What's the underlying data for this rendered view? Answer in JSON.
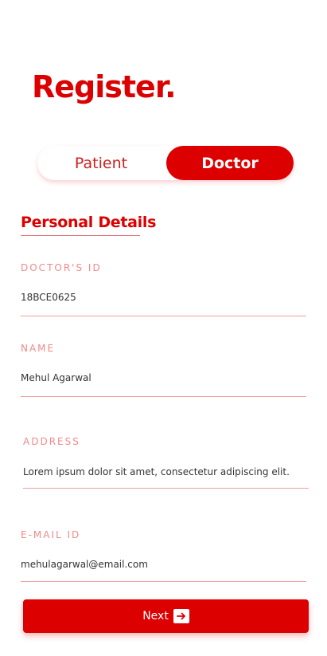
{
  "header": {
    "title": "Register."
  },
  "role_toggle": {
    "options": [
      "Patient",
      "Doctor"
    ],
    "selected": "Doctor"
  },
  "section": {
    "title": "Personal Details"
  },
  "fields": [
    {
      "label": "DOCTOR'S ID",
      "value": "18BCE0625"
    },
    {
      "label": "NAME",
      "value": "Mehul Agarwal"
    },
    {
      "label": "ADDRESS",
      "value": "Lorem ipsum dolor sit amet, consectetur adipiscing elit."
    },
    {
      "label": "E-MAIL ID",
      "value": "mehulagarwal@email.com"
    }
  ],
  "actions": {
    "next_label": "Next"
  },
  "icons": {
    "next": "arrow-right-icon"
  },
  "colors": {
    "accent": "#dc0000",
    "label": "#f08a8a",
    "underline": "#f0a0a0",
    "text": "#333333"
  }
}
